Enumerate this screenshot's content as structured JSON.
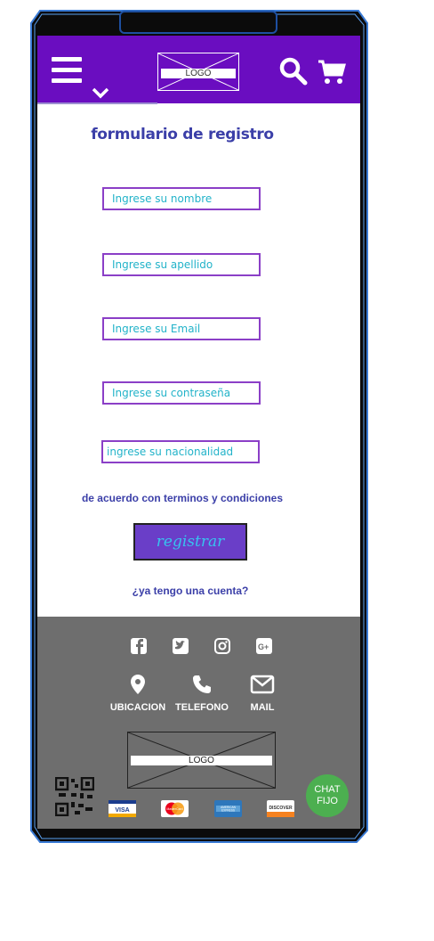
{
  "header": {
    "logo_text": "LOGO",
    "menu_icon": "hamburger-icon",
    "search_icon": "search-icon",
    "cart_icon": "cart-icon",
    "accent_color": "#6a0dc0"
  },
  "form": {
    "title": "formulario de registro",
    "fields": [
      {
        "placeholder": "Ingrese su nombre"
      },
      {
        "placeholder": "Ingrese su apellido"
      },
      {
        "placeholder": "Ingrese su Email"
      },
      {
        "placeholder": "Ingrese su contraseña"
      },
      {
        "placeholder": "ingrese su nacionalidad"
      }
    ],
    "terms": "de acuerdo con terminos y condiciones",
    "submit_label": "registrar",
    "account_link": "¿ya tengo una cuenta?"
  },
  "footer": {
    "social_icons": [
      "facebook-icon",
      "twitter-icon",
      "instagram-icon",
      "google-plus-icon"
    ],
    "contacts": [
      {
        "label": "UBICACION",
        "icon": "location-pin-icon"
      },
      {
        "label": "TELEFONO",
        "icon": "phone-icon"
      },
      {
        "label": "MAIL",
        "icon": "mail-icon"
      }
    ],
    "logo_text": "LOGO",
    "cards": [
      {
        "name": "VISA",
        "icon": "visa-card-icon"
      },
      {
        "name": "MasterCard",
        "icon": "mastercard-icon"
      },
      {
        "name": "AMERICAN EXPRESS",
        "icon": "amex-card-icon"
      },
      {
        "name": "DISCOVER",
        "icon": "discover-card-icon"
      }
    ],
    "chat_label_line1": "CHAT",
    "chat_label_line2": "FIJO",
    "background_color": "#6e6e6e"
  }
}
